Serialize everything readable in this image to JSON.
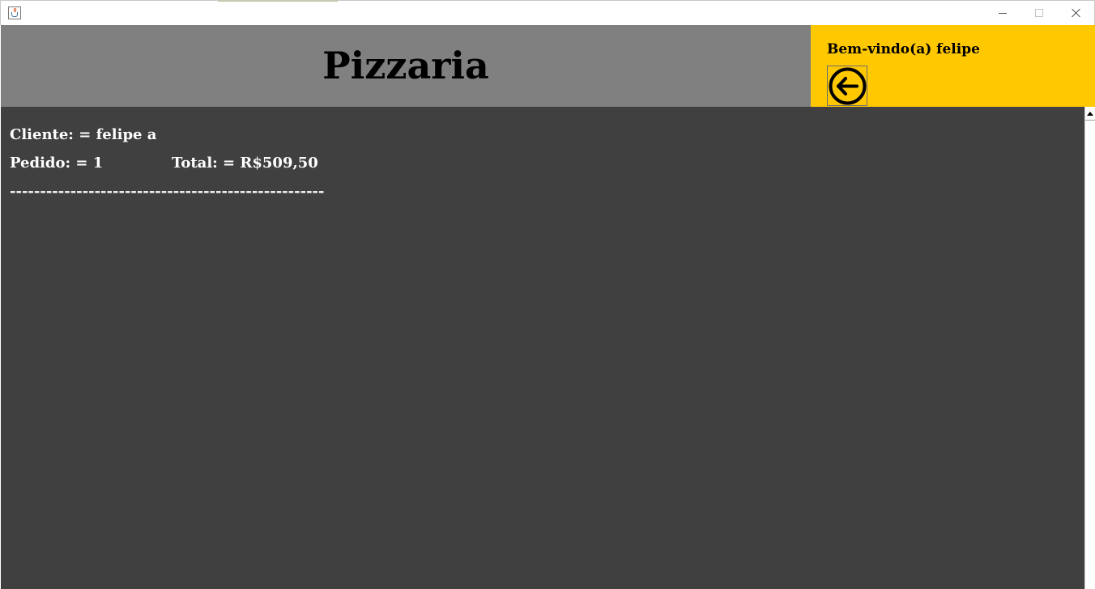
{
  "window": {
    "icon": "java-cup-icon",
    "controls": {
      "minimize": "minimize-icon",
      "maximize": "maximize-icon",
      "close": "close-icon"
    }
  },
  "header": {
    "title": "Pizzaria",
    "welcome": "Bem-vindo(a) felipe",
    "back_icon": "arrow-left-circle-icon",
    "colors": {
      "title_bg": "#808080",
      "user_bg": "#ffc800"
    }
  },
  "order": {
    "cliente": "Cliente: = felipe a",
    "pedido": "Pedido: = 1",
    "total": "Total: = R$509,50",
    "separator": "----------------------------------------------------"
  },
  "colors": {
    "content_bg": "#404040",
    "text": "#ffffff"
  }
}
